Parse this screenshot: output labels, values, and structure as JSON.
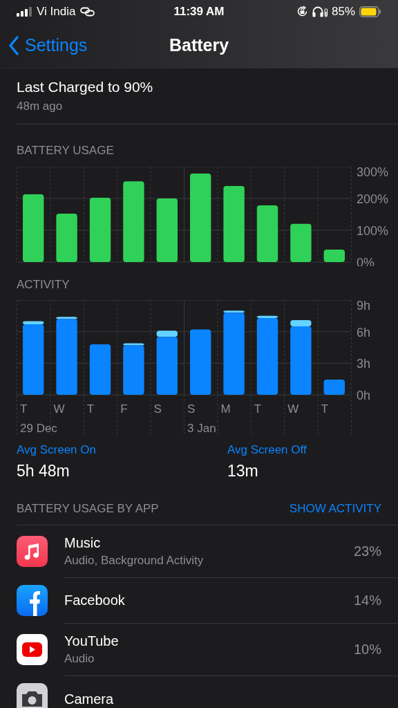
{
  "status_bar": {
    "carrier": "Vi India",
    "time": "11:39 AM",
    "battery_percent": "85%"
  },
  "nav": {
    "back_label": "Settings",
    "title": "Battery"
  },
  "last_charged": {
    "title": "Last Charged to 90%",
    "subtitle": "48m ago"
  },
  "battery_usage": {
    "title": "BATTERY USAGE",
    "chart_data": {
      "type": "bar",
      "series": [
        {
          "color": "#30d158",
          "values": [
            213,
            152,
            202,
            254,
            200,
            278,
            239,
            178,
            120,
            39
          ]
        }
      ],
      "ylim": [
        0,
        300
      ],
      "yticks": [
        {
          "value": 0,
          "label": "0%"
        },
        {
          "value": 100,
          "label": "100%"
        },
        {
          "value": 200,
          "label": "200%"
        },
        {
          "value": 300,
          "label": "300%"
        }
      ]
    }
  },
  "activity": {
    "title": "ACTIVITY",
    "chart_data": {
      "type": "bar",
      "stacked": true,
      "categories": [
        "T",
        "W",
        "T",
        "F",
        "S",
        "S",
        "M",
        "T",
        "W",
        "T"
      ],
      "series": [
        {
          "color": "#0a84ff",
          "values": [
            6.7,
            7.2,
            4.8,
            4.7,
            5.5,
            6.2,
            7.8,
            7.3,
            6.5,
            1.45
          ]
        },
        {
          "color": "#64d2ff",
          "values": [
            0.3,
            0.2,
            0,
            0.2,
            0.6,
            0,
            0.2,
            0.2,
            0.6,
            0
          ]
        }
      ],
      "ylim": [
        0,
        9
      ],
      "yticks": [
        {
          "value": 0,
          "label": "0h"
        },
        {
          "value": 3,
          "label": "3h"
        },
        {
          "value": 6,
          "label": "6h"
        },
        {
          "value": 9,
          "label": "9h"
        }
      ]
    },
    "date_labels": [
      "29 Dec",
      "3 Jan"
    ]
  },
  "averages": [
    {
      "label": "Avg Screen On",
      "value": "5h 48m"
    },
    {
      "label": "Avg Screen Off",
      "value": "13m"
    }
  ],
  "apps_section": {
    "title": "BATTERY USAGE BY APP",
    "action": "SHOW ACTIVITY"
  },
  "apps": [
    {
      "kind": "music",
      "name": "Music",
      "detail": "Audio, Background Activity",
      "percent": "23%"
    },
    {
      "kind": "facebook",
      "name": "Facebook",
      "percent": "14%"
    },
    {
      "kind": "youtube",
      "name": "YouTube",
      "detail": "Audio",
      "percent": "10%"
    },
    {
      "kind": "camera",
      "name": "Camera"
    }
  ]
}
